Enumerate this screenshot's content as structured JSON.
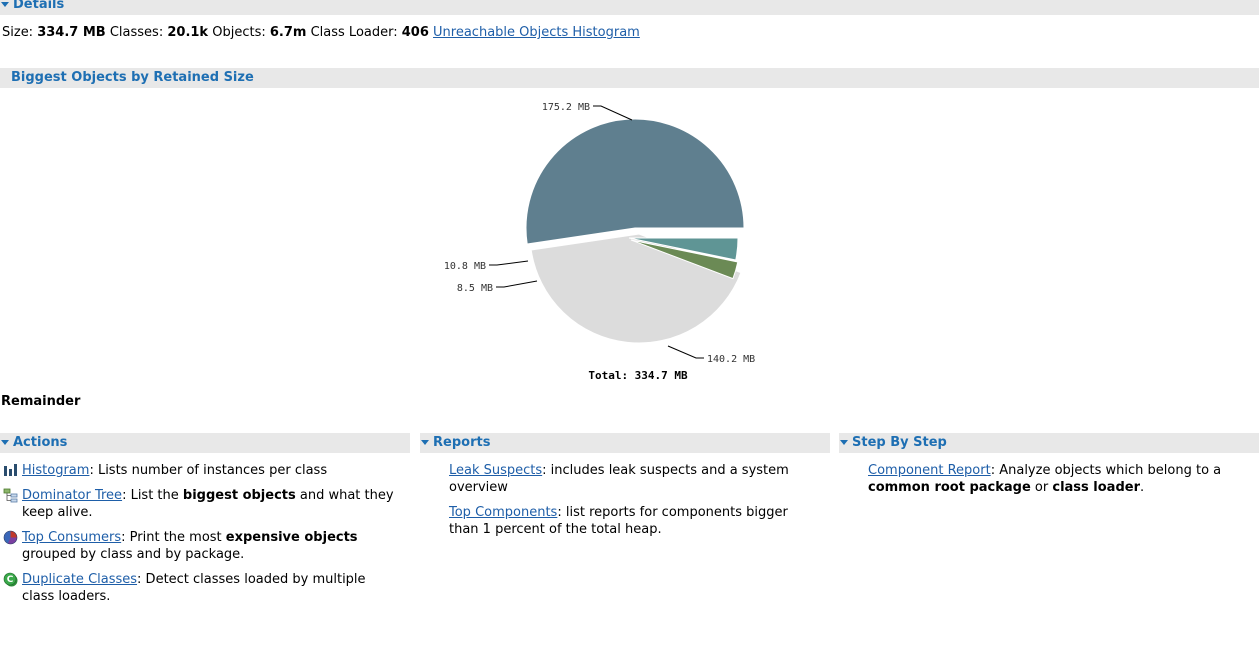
{
  "details": {
    "header": "Details",
    "size_label": "Size:",
    "size_value": "334.7 MB",
    "classes_label": "Classes:",
    "classes_value": "20.1k",
    "objects_label": "Objects:",
    "objects_value": "6.7m",
    "classloader_label": "Class Loader:",
    "classloader_value": "406",
    "histogram_link": "Unreachable Objects Histogram"
  },
  "biggest_objects": {
    "header": "Biggest Objects by Retained Size",
    "remainder_label": "Remainder"
  },
  "chart_data": {
    "type": "pie",
    "unit": "MB",
    "slices": [
      {
        "value": 175.2,
        "label": "175.2 MB",
        "color": "#5f7f8f"
      },
      {
        "value": 140.2,
        "label": "140.2 MB",
        "color": "#dcdcdc"
      },
      {
        "value": 8.5,
        "label": "8.5 MB",
        "color": "#6b8a55"
      },
      {
        "value": 10.8,
        "label": "10.8 MB",
        "color": "#5f9595"
      }
    ],
    "total_label": "Total: 334.7 MB"
  },
  "actions": {
    "header": "Actions",
    "items": [
      {
        "icon": "histogram-icon",
        "link": "Histogram",
        "text_parts": [
          ": Lists number of instances per class"
        ]
      },
      {
        "icon": "dominator-tree-icon",
        "link": "Dominator Tree",
        "text_parts": [
          ": List the ",
          "biggest objects",
          " and what they keep alive."
        ]
      },
      {
        "icon": "top-consumers-icon",
        "link": "Top Consumers",
        "text_parts": [
          ": Print the most ",
          "expensive objects",
          " grouped by class and by package."
        ]
      },
      {
        "icon": "duplicate-classes-icon",
        "link": "Duplicate Classes",
        "text_parts": [
          ": Detect classes loaded by multiple class loaders."
        ]
      }
    ]
  },
  "reports": {
    "header": "Reports",
    "items": [
      {
        "link": "Leak Suspects",
        "text_parts": [
          ": includes leak suspects and a system overview"
        ]
      },
      {
        "link": "Top Components",
        "text_parts": [
          ": list reports for components bigger than 1 percent of the total heap."
        ]
      }
    ]
  },
  "step_by_step": {
    "header": "Step By Step",
    "items": [
      {
        "link": "Component Report",
        "text_parts": [
          ": Analyze objects which belong to a ",
          "common root package",
          " or ",
          "class loader",
          "."
        ]
      }
    ]
  }
}
